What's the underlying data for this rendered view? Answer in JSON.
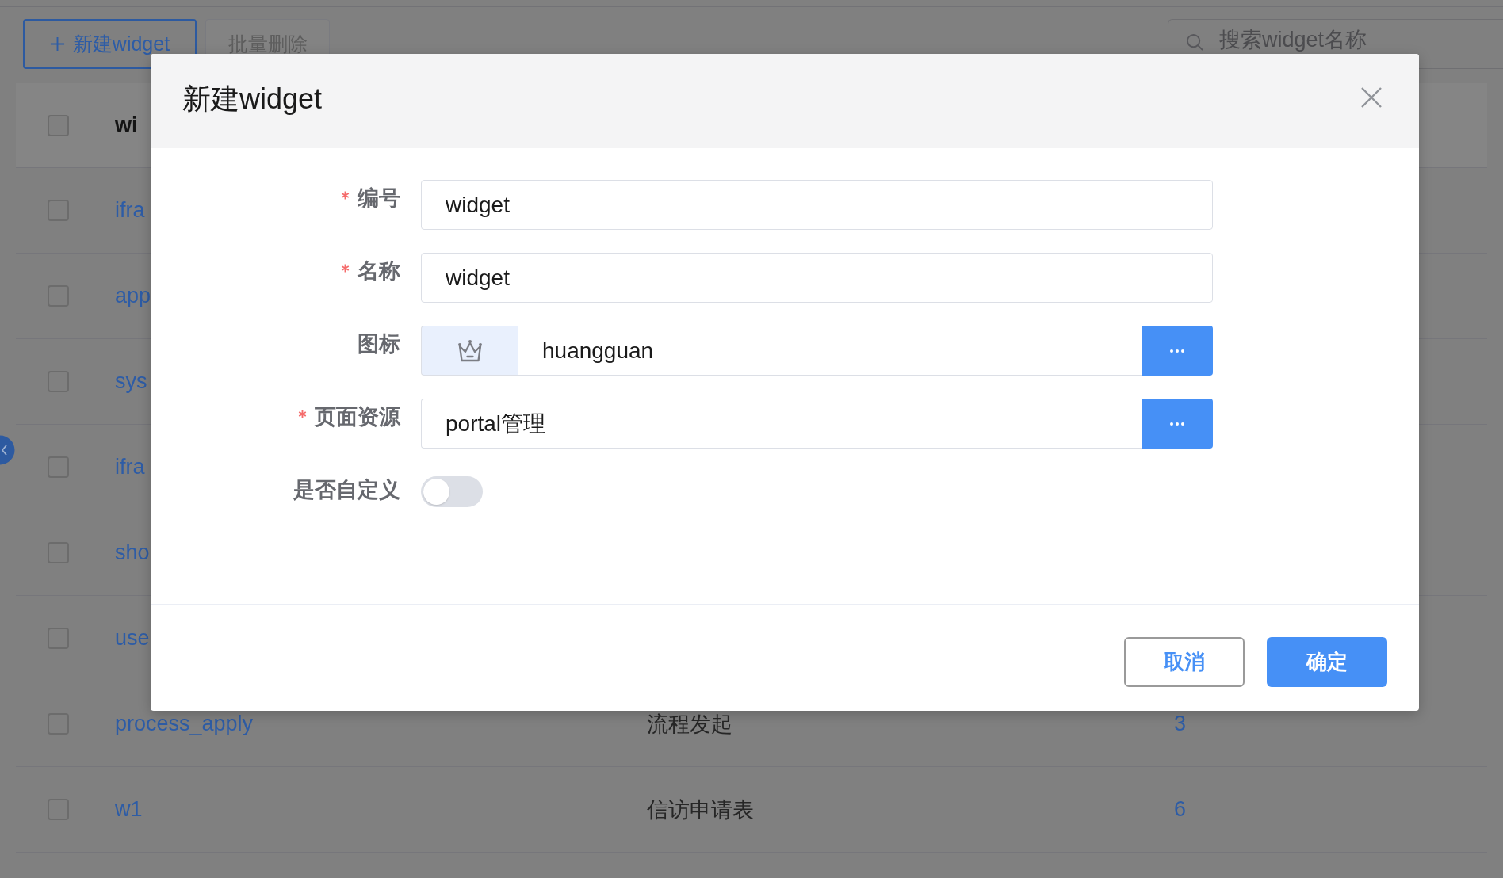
{
  "toolbar": {
    "create_button": {
      "label": "新建widget"
    },
    "batch_delete_button": {
      "label": "批量删除",
      "disabled": true
    },
    "search": {
      "placeholder": "搜索widget名称"
    }
  },
  "table": {
    "header": {
      "checked": false,
      "columns": [
        "wi"
      ]
    },
    "rows": [
      {
        "checked": false,
        "cells": [
          "ifra"
        ]
      },
      {
        "checked": false,
        "cells": [
          "app"
        ]
      },
      {
        "checked": false,
        "cells": [
          "sys"
        ]
      },
      {
        "checked": false,
        "cells": [
          "ifra"
        ]
      },
      {
        "checked": false,
        "cells": [
          "sho"
        ]
      },
      {
        "checked": false,
        "cells": [
          "use"
        ]
      },
      {
        "checked": false,
        "cells": [
          "process_apply",
          "流程发起",
          "3"
        ]
      },
      {
        "checked": false,
        "cells": [
          "w1",
          "信访申请表",
          "6"
        ]
      }
    ]
  },
  "dialog": {
    "title": "新建widget",
    "fields": [
      {
        "kind": "text",
        "label": "编号",
        "required": true,
        "value": "widget"
      },
      {
        "kind": "text",
        "label": "名称",
        "required": true,
        "value": "widget"
      },
      {
        "kind": "icon-picker",
        "label": "图标",
        "required": false,
        "value": "huangguan"
      },
      {
        "kind": "picker",
        "label": "页面资源",
        "required": true,
        "value": "portal管理"
      },
      {
        "kind": "switch",
        "label": "是否自定义",
        "required": false,
        "on": false
      }
    ],
    "buttons": [
      {
        "kind": "secondary",
        "label": "取消"
      },
      {
        "kind": "primary",
        "label": "确定"
      }
    ]
  }
}
